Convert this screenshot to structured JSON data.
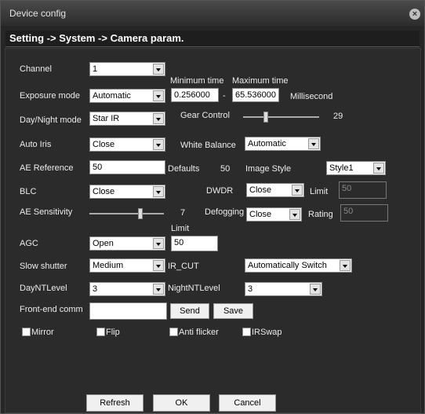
{
  "window": {
    "title": "Device config",
    "breadcrumb": "Setting -> System -> Camera param."
  },
  "channel": {
    "label": "Channel",
    "value": "1"
  },
  "exposure": {
    "label": "Exposure mode",
    "value": "Automatic",
    "min_label": "Minimum time",
    "max_label": "Maximum time",
    "min_value": "0.256000",
    "dash": "-",
    "max_value": "65.536000",
    "unit": "Millisecond"
  },
  "daynight": {
    "label": "Day/Night mode",
    "value": "Star IR"
  },
  "gear": {
    "label": "Gear Control",
    "value": "29",
    "level": 29,
    "max": 100
  },
  "autoiris": {
    "label": "Auto Iris",
    "value": "Close"
  },
  "whitebalance": {
    "label": "White Balance",
    "value": "Automatic"
  },
  "aeref": {
    "label": "AE Reference",
    "value": "50",
    "defaults_label": "Defaults",
    "defaults_value": "50"
  },
  "imagestyle": {
    "label": "Image Style",
    "value": "Style1"
  },
  "blc": {
    "label": "BLC",
    "value": "Close"
  },
  "dwdr": {
    "label": "DWDR",
    "value": "Close",
    "limit_label": "Limit",
    "limit_value": "50"
  },
  "aesens": {
    "label": "AE Sensitivity",
    "value": "7",
    "level": 7,
    "max": 10
  },
  "defogging": {
    "label": "Defogging",
    "value": "Close",
    "rating_label": "Rating",
    "rating_value": "50"
  },
  "agc": {
    "label": "AGC",
    "value": "Open",
    "limit_label": "Limit",
    "limit_value": "50"
  },
  "slowshutter": {
    "label": "Slow shutter",
    "value": "Medium"
  },
  "ircut": {
    "label": "IR_CUT",
    "value": "Automatically Switch"
  },
  "dayntlevel": {
    "label": "DayNTLevel",
    "value": "3"
  },
  "nightntlevel": {
    "label": "NightNTLevel",
    "value": "3"
  },
  "frontend": {
    "label": "Front-end comm",
    "value": "",
    "send_label": "Send",
    "save_label": "Save"
  },
  "checks": {
    "mirror": "Mirror",
    "flip": "Flip",
    "antiflicker": "Anti flicker",
    "irswap": "IRSwap"
  },
  "footer": {
    "refresh": "Refresh",
    "ok": "OK",
    "cancel": "Cancel"
  }
}
